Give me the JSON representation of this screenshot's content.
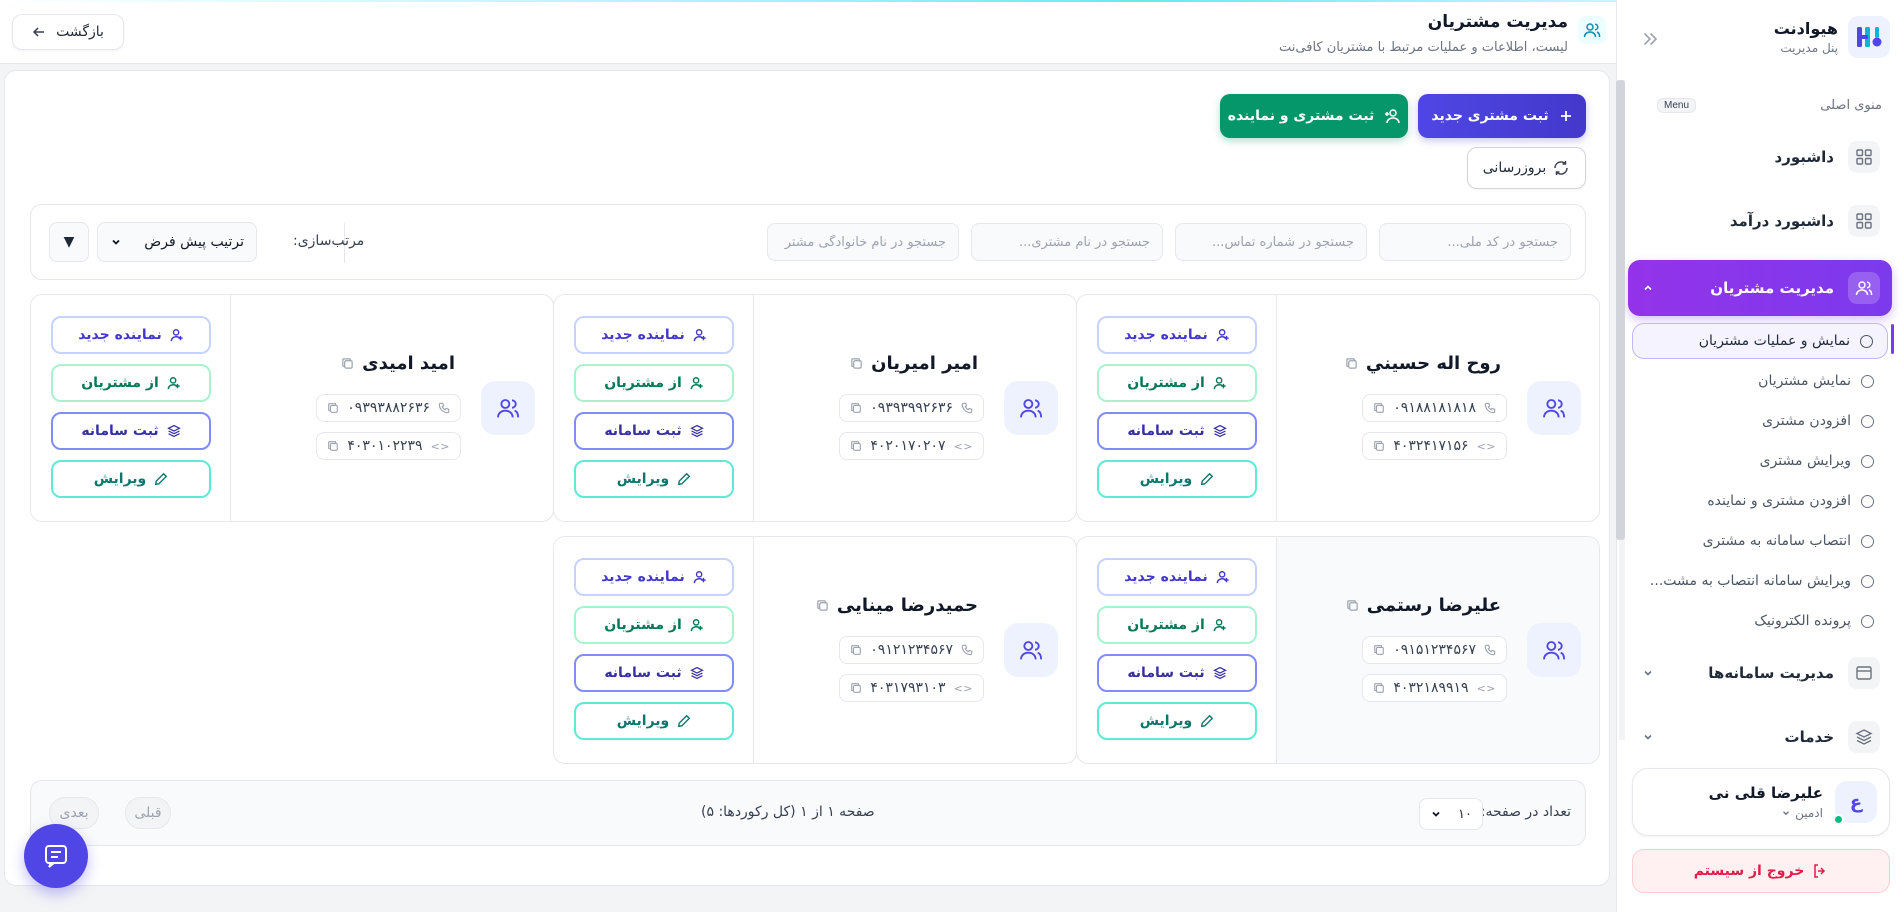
{
  "brand": {
    "name": "هیوادنت",
    "sub": "پنل مدیریت"
  },
  "menu": {
    "title": "منوی اصلی",
    "badge": "Menu"
  },
  "nav": {
    "dashboard": "داشبورد",
    "income_dashboard": "داشبورد درآمد",
    "customers": "مدیریت مشتریان",
    "systems": "مدیریت سامانه‌ها",
    "services": "خدمات"
  },
  "subnav": [
    "نمایش و عملیات مشتریان",
    "نمایش مشتریان",
    "افزودن مشتری",
    "ویرایش مشتری",
    "افزودن مشتری و نماینده",
    "انتصاب سامانه به مشتری",
    "ویرایش سامانه انتصاب به مشت...",
    "پرونده الکترونیک"
  ],
  "user": {
    "initial": "ع",
    "name": "علیرضا قلی نی",
    "role": "ادمین"
  },
  "logout": "خروج از سیستم",
  "header": {
    "title": "مدیریت مشتریان",
    "subtitle": "لیست، اطلاعات و عملیات مرتبط با مشتریان کافی‌نت",
    "back": "بازگشت"
  },
  "actions": {
    "new_customer": "ثبت مشتری جدید",
    "new_customer_agent": "ثبت مشتری و نماینده",
    "refresh": "بروزرسانی"
  },
  "filters": {
    "national_code": "جستجو در کد ملی...",
    "phone": "جستجو در شماره تماس...",
    "name": "جستجو در نام مشتری...",
    "family": "جستجو در نام خانوادگی مشتر",
    "sort_label": "مرتب‌سازی:",
    "sort_value": "ترتیب پیش فرض",
    "sort_dir": "▼"
  },
  "card_actions": {
    "new_agent": "نماینده جدید",
    "from_customers": "از مشتریان",
    "register_system": "ثبت سامانه",
    "edit": "ویرایش"
  },
  "customers": [
    {
      "name": "روح اله حسيني",
      "phone": "۰۹۱۸۸۱۸۱۸۱۸",
      "code": "۴۰۳۲۴۱۷۱۵۶"
    },
    {
      "name": "امیر امیریان",
      "phone": "۰۹۳۹۳۹۹۲۶۳۶",
      "code": "۴۰۲۰۱۷۰۲۰۷"
    },
    {
      "name": "امید امیدی",
      "phone": "۰۹۳۹۳۸۸۲۶۳۶",
      "code": "۴۰۳۰۱۰۲۲۳۹"
    },
    {
      "name": "علیرضا رستمی",
      "phone": "۰۹۱۵۱۲۳۴۵۶۷",
      "code": "۴۰۳۲۱۸۹۹۱۹"
    },
    {
      "name": "حمیدرضا مینایی",
      "phone": "۰۹۱۲۱۲۳۴۵۶۷",
      "code": "۴۰۳۱۷۹۳۱۰۳"
    }
  ],
  "pager": {
    "per_page_label": "تعداد در صفحه:",
    "per_page": "۱۰",
    "info": "صفحه ۱ از ۱   (کل رکوردها: ۵)",
    "prev": "قبلی",
    "next": "بعدی"
  },
  "colors": {
    "primary": "#4f46e5",
    "green": "#059669",
    "active_nav": "#7c3aed",
    "logout": "#e11d48"
  }
}
